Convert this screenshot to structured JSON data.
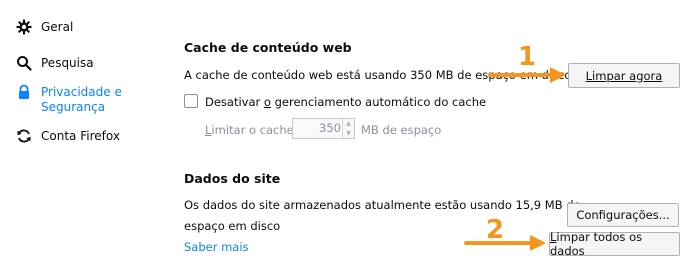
{
  "sidebar": {
    "items": [
      {
        "label": "Geral",
        "icon": "gear-icon"
      },
      {
        "label": "Pesquisa",
        "icon": "search-icon"
      },
      {
        "label": "Privacidade e Segurança",
        "icon": "lock-icon",
        "active": true
      },
      {
        "label": "Conta Firefox",
        "icon": "sync-icon"
      }
    ]
  },
  "cache": {
    "title": "Cache de conteúdo web",
    "usage_text": "A cache de conteúdo web está usando 350 MB de espaço em disco",
    "clear_button": "Limpar agora",
    "override_checkbox_label_prefix": "Desativar ",
    "override_checkbox_label_accesskey": "o",
    "override_checkbox_label_suffix": " gerenciamento automático do cache",
    "limit_label_accesskey": "L",
    "limit_label_rest": "imitar o cache a",
    "limit_value": "350",
    "limit_unit": "MB de espaço"
  },
  "site_data": {
    "title": "Dados do site",
    "usage_text_line1": "Os dados do site armazenados atualmente estão usando 15,9 MB de",
    "usage_text_line2": "espaço em disco",
    "learn_more": "Saber mais",
    "settings_button_pre": "Conf",
    "settings_button_key": "i",
    "settings_button_post": "gurações...",
    "clear_all_button_key": "L",
    "clear_all_button_rest": "impar todos os dados"
  },
  "annotations": {
    "step1": "1",
    "step2": "2",
    "color": "#f7941d"
  },
  "theme": {
    "accent": "#0a84ff",
    "text": "#0c0c0d",
    "muted": "#8f8f9d"
  }
}
